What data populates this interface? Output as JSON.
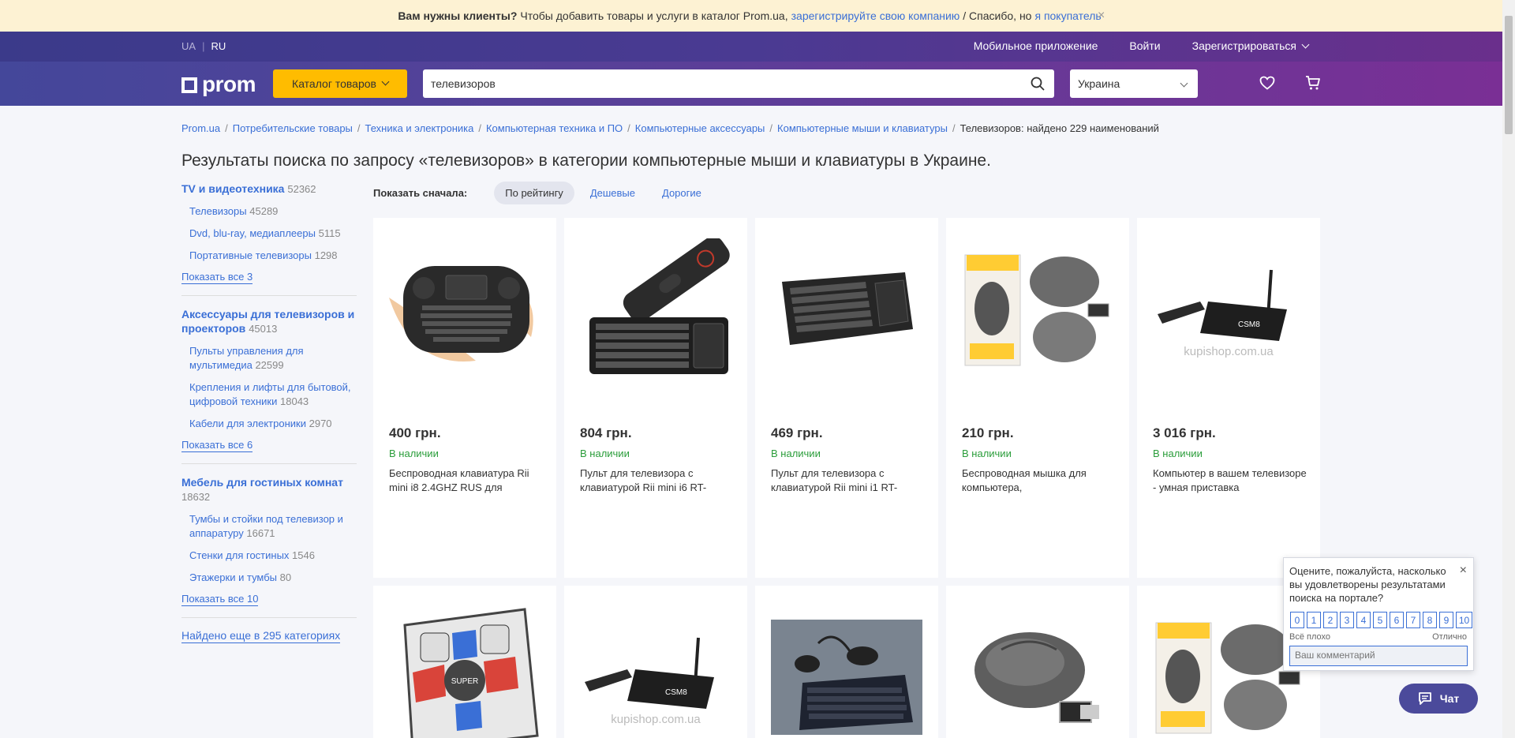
{
  "notice": {
    "bold": "Вам нужны клиенты?",
    "text1": "Чтобы добавить товары и услуги в каталог Prom.ua,",
    "link1": "зарегистрируйте свою компанию",
    "text2": "/ Спасибо, но",
    "link2": "я покупатель",
    "close": "×"
  },
  "header": {
    "langs": [
      "UA",
      "RU"
    ],
    "lang_sep": "|",
    "mobile_app": "Мобильное приложение",
    "login": "Войти",
    "register": "Зарегистрироваться",
    "logo": "prom",
    "catalog_label": "Каталог товаров",
    "search_value": "телевизоров",
    "region": "Украина"
  },
  "breadcrumb": {
    "items": [
      "Prom.ua",
      "Потребительские товары",
      "Техника и электроника",
      "Компьютерная техника и ПО",
      "Компьютерные аксессуары",
      "Компьютерные мыши и клавиатуры"
    ],
    "separator": "/",
    "current": "Телевизоров: найдено 229 наименований"
  },
  "page_title": "Результаты поиска по запросу «телевизоров» в категории компьютерные мыши и клавиатуры в Украине.",
  "sidebar": {
    "groups": [
      {
        "title": "TV и видеотехника",
        "count": "52362",
        "items": [
          {
            "label": "Телевизоры",
            "count": "45289"
          },
          {
            "label": "Dvd, blu-ray, медиаплееры",
            "count": "5115"
          },
          {
            "label": "Портативные телевизоры",
            "count": "1298"
          }
        ],
        "show_all": "Показать все 3"
      },
      {
        "title": "Аксессуары для телевизоров и проекторов",
        "count": "45013",
        "items": [
          {
            "label": "Пульты управления для мультимедиа",
            "count": "22599"
          },
          {
            "label": "Крепления и лифты для бытовой, цифровой техники",
            "count": "18043"
          },
          {
            "label": "Кабели для электроники",
            "count": "2970"
          }
        ],
        "show_all": "Показать все 6"
      },
      {
        "title": "Мебель для гостиных комнат",
        "count": "18632",
        "items": [
          {
            "label": "Тумбы и стойки под телевизор и аппаратуру",
            "count": "16671"
          },
          {
            "label": "Стенки для гостиных",
            "count": "1546"
          },
          {
            "label": "Этажерки и тумбы",
            "count": "80"
          }
        ],
        "show_all": "Показать все 10"
      }
    ],
    "found_more": "Найдено еще в 295 категориях"
  },
  "sort": {
    "label": "Показать сначала:",
    "options": [
      "По рейтингу",
      "Дешевые",
      "Дорогие"
    ]
  },
  "products": [
    {
      "price": "400 грн.",
      "availability": "В наличии",
      "title": "Беспроводная клавиатура Rii mini i8 2.4GHZ RUS для",
      "image": "mini-keyboard-touchpad"
    },
    {
      "price": "804 грн.",
      "availability": "В наличии",
      "title": "Пульт для телевизора с клавиатурой Rii mini i6 RT-",
      "image": "remote-keyboard"
    },
    {
      "price": "469 грн.",
      "availability": "В наличии",
      "title": "Пульт для телевизора с клавиатурой Rii mini i1 RT-",
      "image": "compact-keyboard"
    },
    {
      "price": "210 грн.",
      "availability": "В наличии",
      "title": "Беспроводная мышка для компьютера,",
      "image": "wireless-mouse"
    },
    {
      "price": "3 016 грн.",
      "availability": "В наличии",
      "title": "Компьютер в вашем телевизоре - умная приставка",
      "image": "tv-box",
      "watermark": "kupishop.com.ua"
    },
    {
      "image": "dance-mat",
      "mat_text": "SUPER"
    },
    {
      "image": "tv-box",
      "watermark": "kupishop.com.ua"
    },
    {
      "image": "keyboard-mouse-photo"
    },
    {
      "image": "wireless-mouse-2"
    },
    {
      "image": "wireless-mouse"
    }
  ],
  "rating_popup": {
    "question": "Оцените, пожалуйста, насколько вы удовлетворены результатами поиска на портале?",
    "close": "×",
    "scale": [
      "0",
      "1",
      "2",
      "3",
      "4",
      "5",
      "6",
      "7",
      "8",
      "9",
      "10"
    ],
    "label_bad": "Всё плохо",
    "label_good": "Отлично",
    "comment_placeholder": "Ваш комментарий"
  },
  "chat": {
    "label": "Чат"
  },
  "colors": {
    "accent": "#3a6fd6",
    "brand_yellow": "#ffbc00",
    "header_purple": "#4a3a92",
    "in_stock": "#2a9d3a"
  }
}
